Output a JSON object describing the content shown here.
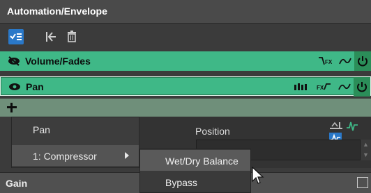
{
  "window": {
    "title": "Automation/Envelope"
  },
  "toolbar": {
    "buttons": [
      {
        "name": "show-list-button",
        "icon": "checklist-icon"
      },
      {
        "name": "go-start-button",
        "icon": "go-to-start-icon"
      },
      {
        "name": "delete-button",
        "icon": "trash-icon"
      }
    ]
  },
  "tracks": [
    {
      "label": "Volume/Fades",
      "visible": false,
      "color": "#3fb887"
    },
    {
      "label": "Pan",
      "visible": true,
      "selected": true,
      "color": "#3fb887"
    }
  ],
  "add_row": {
    "icon": "plus-icon"
  },
  "panel": {
    "position_label": "Position"
  },
  "gain": {
    "label": "Gain"
  },
  "context_menu": {
    "items": [
      {
        "label": "Pan"
      },
      {
        "label": "1: Compressor",
        "has_submenu": true
      }
    ],
    "submenu": [
      {
        "label": "Wet/Dry Balance",
        "highlighted": true
      },
      {
        "label": "Bypass"
      }
    ]
  },
  "colors": {
    "track_green": "#3fb887",
    "power_green": "#2b8e59",
    "title_bg": "#4a4a4a",
    "accent_blue": "#2a78c8"
  }
}
